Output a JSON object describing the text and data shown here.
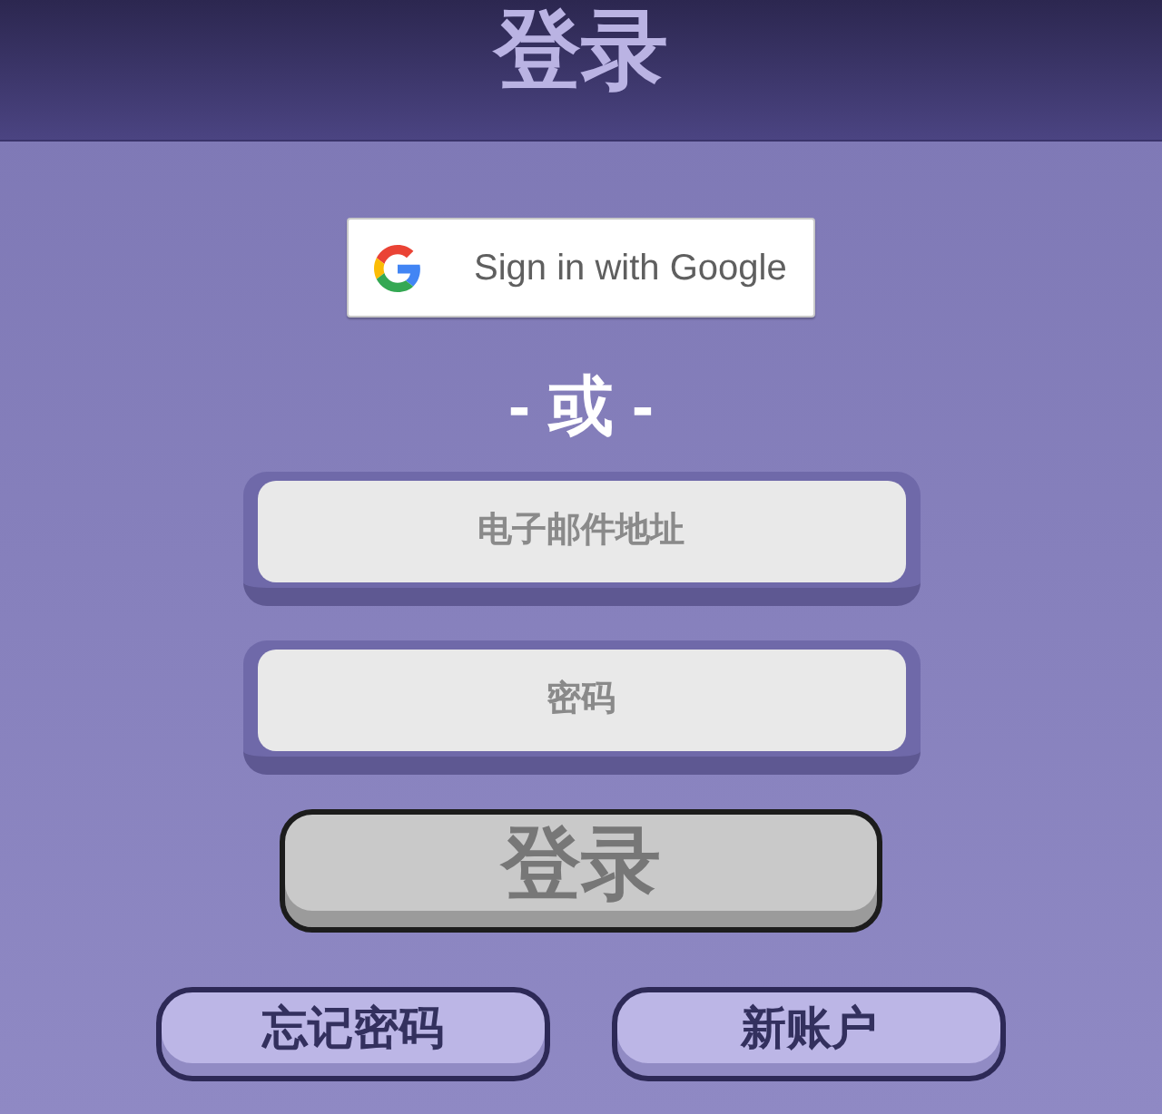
{
  "header": {
    "title": "登录"
  },
  "google_button": {
    "label": "Sign in with Google"
  },
  "divider": {
    "text": "- 或 -"
  },
  "fields": [
    {
      "placeholder": "电子邮件地址"
    },
    {
      "placeholder": "密码"
    }
  ],
  "login_button": {
    "label": "登录"
  },
  "links": [
    {
      "label": "忘记密码"
    },
    {
      "label": "新账户"
    }
  ]
}
